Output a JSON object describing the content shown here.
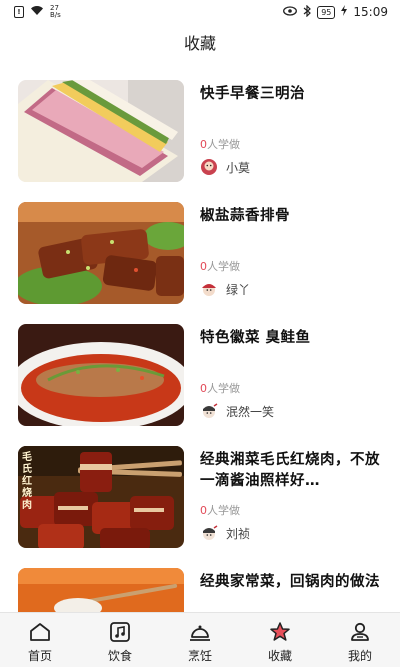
{
  "status_bar": {
    "net_speed_value": "27",
    "net_speed_unit": "B/s",
    "battery": "95",
    "time": "15:09"
  },
  "header": {
    "title": "收藏"
  },
  "favorites": [
    {
      "title": "快手早餐三明治",
      "learn_count": "0",
      "learn_suffix": "人学做",
      "author": "小莫"
    },
    {
      "title": "椒盐蒜香排骨",
      "learn_count": "0",
      "learn_suffix": "人学做",
      "author": "绿丫"
    },
    {
      "title": "特色徽菜 臭鲑鱼",
      "learn_count": "0",
      "learn_suffix": "人学做",
      "author": "泯然一笑"
    },
    {
      "title": "经典湘菜毛氏红烧肉，不放一滴酱油照样好…",
      "learn_count": "0",
      "learn_suffix": "人学做",
      "author": "刘祯",
      "image_caption": "毛氏红烧肉"
    },
    {
      "title": "经典家常菜，回锅肉的做法"
    }
  ],
  "tabs": [
    {
      "label": "首页",
      "icon": "home-icon",
      "active": false
    },
    {
      "label": "饮食",
      "icon": "music-note-icon",
      "active": false
    },
    {
      "label": "烹饪",
      "icon": "cloche-icon",
      "active": false
    },
    {
      "label": "收藏",
      "icon": "star-icon",
      "active": true
    },
    {
      "label": "我的",
      "icon": "user-icon",
      "active": false
    }
  ],
  "colors": {
    "accent": "#e24a58",
    "star": "#e8505b"
  }
}
